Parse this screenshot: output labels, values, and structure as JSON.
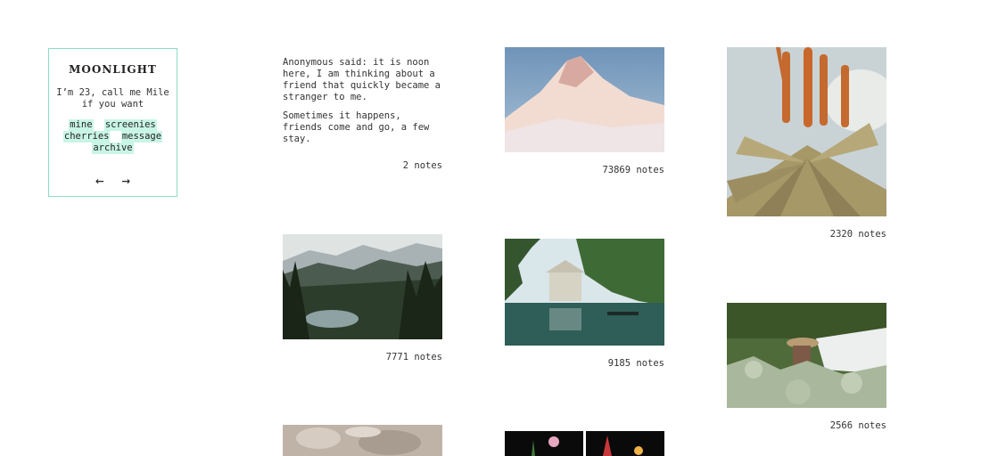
{
  "sidebar": {
    "title": "MOONLIGHT",
    "bio": "I’m 23, call me Mile if you want",
    "links": [
      "mine",
      "screenies",
      "cherries",
      "message",
      "archive"
    ],
    "prev_arrow": "←",
    "next_arrow": "→"
  },
  "posts": {
    "ask": {
      "question": "Anonymous said: it is noon here, I am thinking about a friend that quickly became a stranger to me.",
      "answer": "Sometimes it happens, friends come and go, a few stay.",
      "notes": "2 notes"
    },
    "mountain": {
      "notes": "73869 notes"
    },
    "aloe": {
      "notes": "2320 notes"
    },
    "forest": {
      "notes": "7771 notes"
    },
    "temple": {
      "notes": "9185 notes"
    },
    "garden": {
      "notes": "2566 notes"
    }
  }
}
